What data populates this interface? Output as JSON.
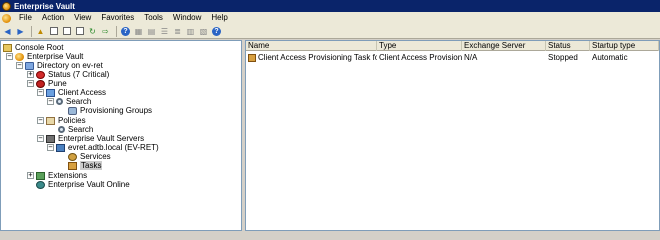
{
  "window": {
    "title": "Enterprise Vault"
  },
  "menu": [
    "File",
    "Action",
    "View",
    "Favorites",
    "Tools",
    "Window",
    "Help"
  ],
  "tree": {
    "console_root": "Console Root",
    "enterprise_vault": "Enterprise Vault",
    "directory": "Directory on ev-ret",
    "status": "Status (7 Critical)",
    "site": "Pune",
    "client_access": "Client Access",
    "search_1": "Search",
    "provisioning_groups": "Provisioning Groups",
    "policies": "Policies",
    "search_2": "Search",
    "ev_servers": "Enterprise Vault Servers",
    "server": "evret.adtb.local (EV-RET)",
    "services": "Services",
    "tasks": "Tasks",
    "extensions": "Extensions",
    "ev_online": "Enterprise Vault Online"
  },
  "list": {
    "columns": [
      "Name",
      "Type",
      "Exchange Server",
      "Status",
      "Startup type"
    ],
    "rows": [
      {
        "name": "Client Access Provisioning Task for ADIT...",
        "type": "Client Access Provisioning",
        "exchange_server": "N/A",
        "status": "Stopped",
        "startup_type": "Automatic"
      }
    ]
  }
}
